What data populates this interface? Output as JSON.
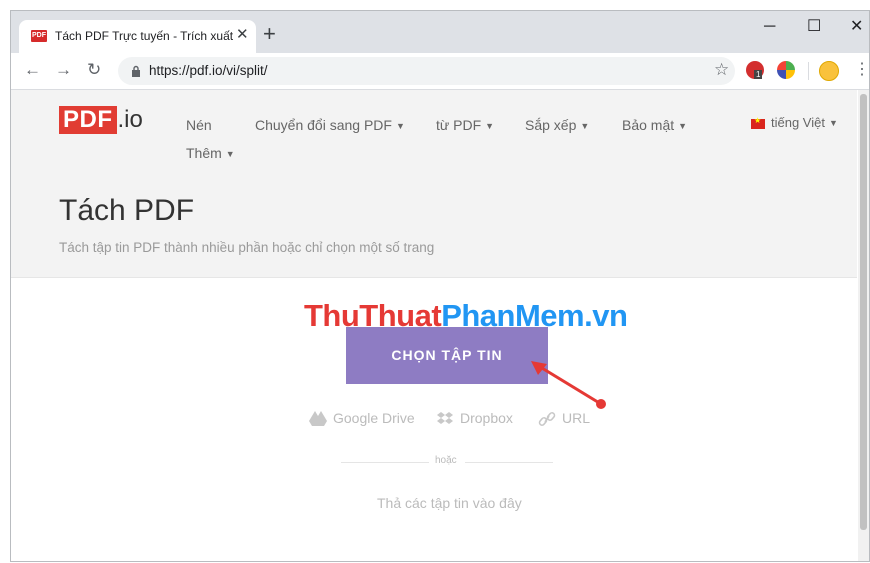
{
  "browser": {
    "tab": {
      "favicon_text": "PDF",
      "title": "Tách PDF Trực tuyến - Trích xuất T"
    },
    "new_tab": "+",
    "window": {
      "minimize": "─",
      "maximize": "☐",
      "close": "✕"
    },
    "url": "https://pdf.io/vi/split/",
    "extensions": [
      "abp-icon",
      "globe-extension-icon",
      "emoji-avatar-icon"
    ],
    "extension_badge": "1"
  },
  "site": {
    "logo": {
      "pdf": "PDF",
      "io": ".io"
    },
    "nav": [
      {
        "label": "Nén",
        "dropdown": false
      },
      {
        "label": "Chuyển đổi sang PDF",
        "dropdown": true
      },
      {
        "label": "từ PDF",
        "dropdown": true
      },
      {
        "label": "Sắp xếp",
        "dropdown": true
      },
      {
        "label": "Bảo mật",
        "dropdown": true
      },
      {
        "label": "Thêm",
        "dropdown": true
      }
    ],
    "language": "tiếng Việt",
    "page_title": "Tách PDF",
    "page_subtitle": "Tách tập tin PDF thành nhiều phần hoặc chỉ chọn một số trang"
  },
  "upload": {
    "watermark_part1": "ThuThuat",
    "watermark_part2": "PhanMem.vn",
    "choose_button": "CHỌN TẬP TIN",
    "sources": [
      "Google Drive",
      "Dropbox",
      "URL"
    ],
    "or_label": "hoặc",
    "drop_hint": "Thả các tập tin vào đây"
  },
  "colors": {
    "logo_red": "#e13c33",
    "button_purple": "#8e7cc3",
    "arrow_red": "#e53935"
  }
}
